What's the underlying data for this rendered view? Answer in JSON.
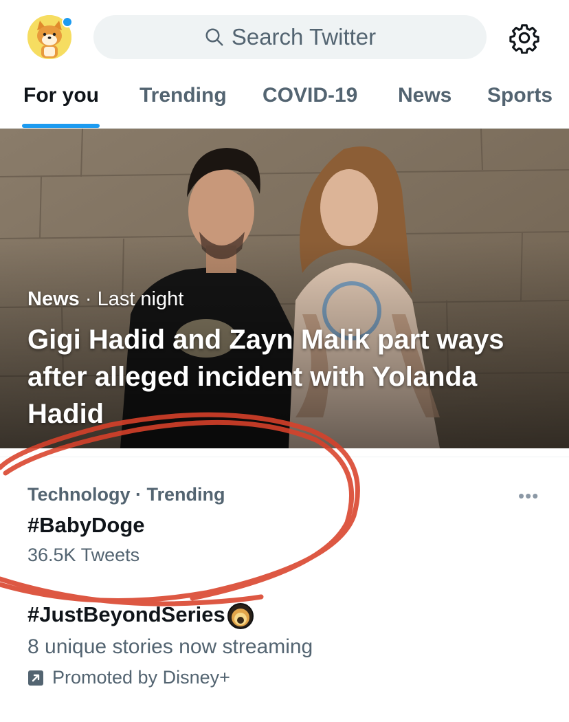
{
  "header": {
    "search_placeholder": "Search Twitter",
    "avatar_icon": "shiba-dog-avatar-icon",
    "settings_icon": "gear-icon",
    "accent": "#1d9bf0"
  },
  "tabs": [
    {
      "label": "For you",
      "active": true
    },
    {
      "label": "Trending"
    },
    {
      "label": "COVID-19"
    },
    {
      "label": "News"
    },
    {
      "label": "Sports"
    }
  ],
  "hero": {
    "category": "News",
    "time": "Last night",
    "separator": "·",
    "headline": "Gigi Hadid and Zayn Malik part ways after alleged incident with Yolanda Hadid"
  },
  "trend": {
    "meta": "Technology · Trending",
    "name": "#BabyDoge",
    "count": "36.5K Tweets",
    "more_icon": "more-dots-icon"
  },
  "promoted": {
    "name": "#JustBeyondSeries",
    "description": "8 unique stories now streaming",
    "by": "Promoted by Disney+",
    "icon": "promoted-arrow-icon"
  },
  "annotation_color": "#d9412a"
}
